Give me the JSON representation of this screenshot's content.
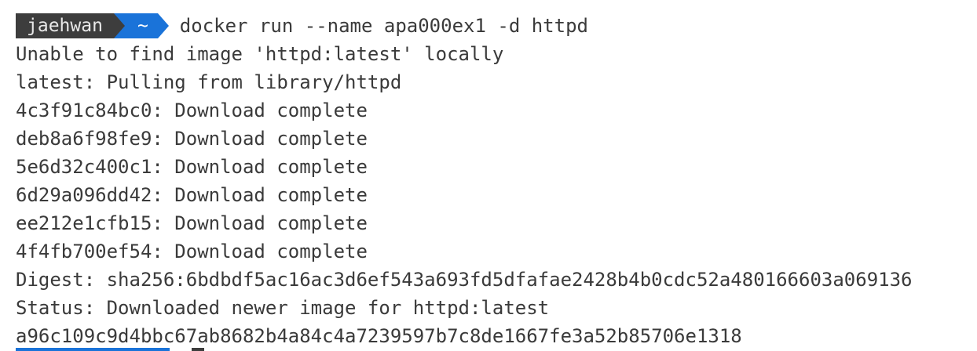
{
  "prompt": {
    "user": "jaehwan",
    "dir": "~",
    "command": "docker run --name apa000ex1 -d httpd"
  },
  "output": [
    "Unable to find image 'httpd:latest' locally",
    "latest: Pulling from library/httpd",
    "4c3f91c84bc0: Download complete",
    "deb8a6f98fe9: Download complete",
    "5e6d32c400c1: Download complete",
    "6d29a096dd42: Download complete",
    "ee212e1cfb15: Download complete",
    "4f4fb700ef54: Download complete",
    "Digest: sha256:6bdbdf5ac16ac3d6ef543a693fd5dfafae2428b4b0cdc52a480166603a069136",
    "Status: Downloaded newer image for httpd:latest",
    "a96c109c9d4bbc67ab8682b4a84c4a7239597b7c8de1667fe3a52b85706e1318"
  ],
  "colors": {
    "user_segment": "#3d3d3d",
    "dir_segment": "#1a73d9",
    "text": "#3a3a3a"
  }
}
